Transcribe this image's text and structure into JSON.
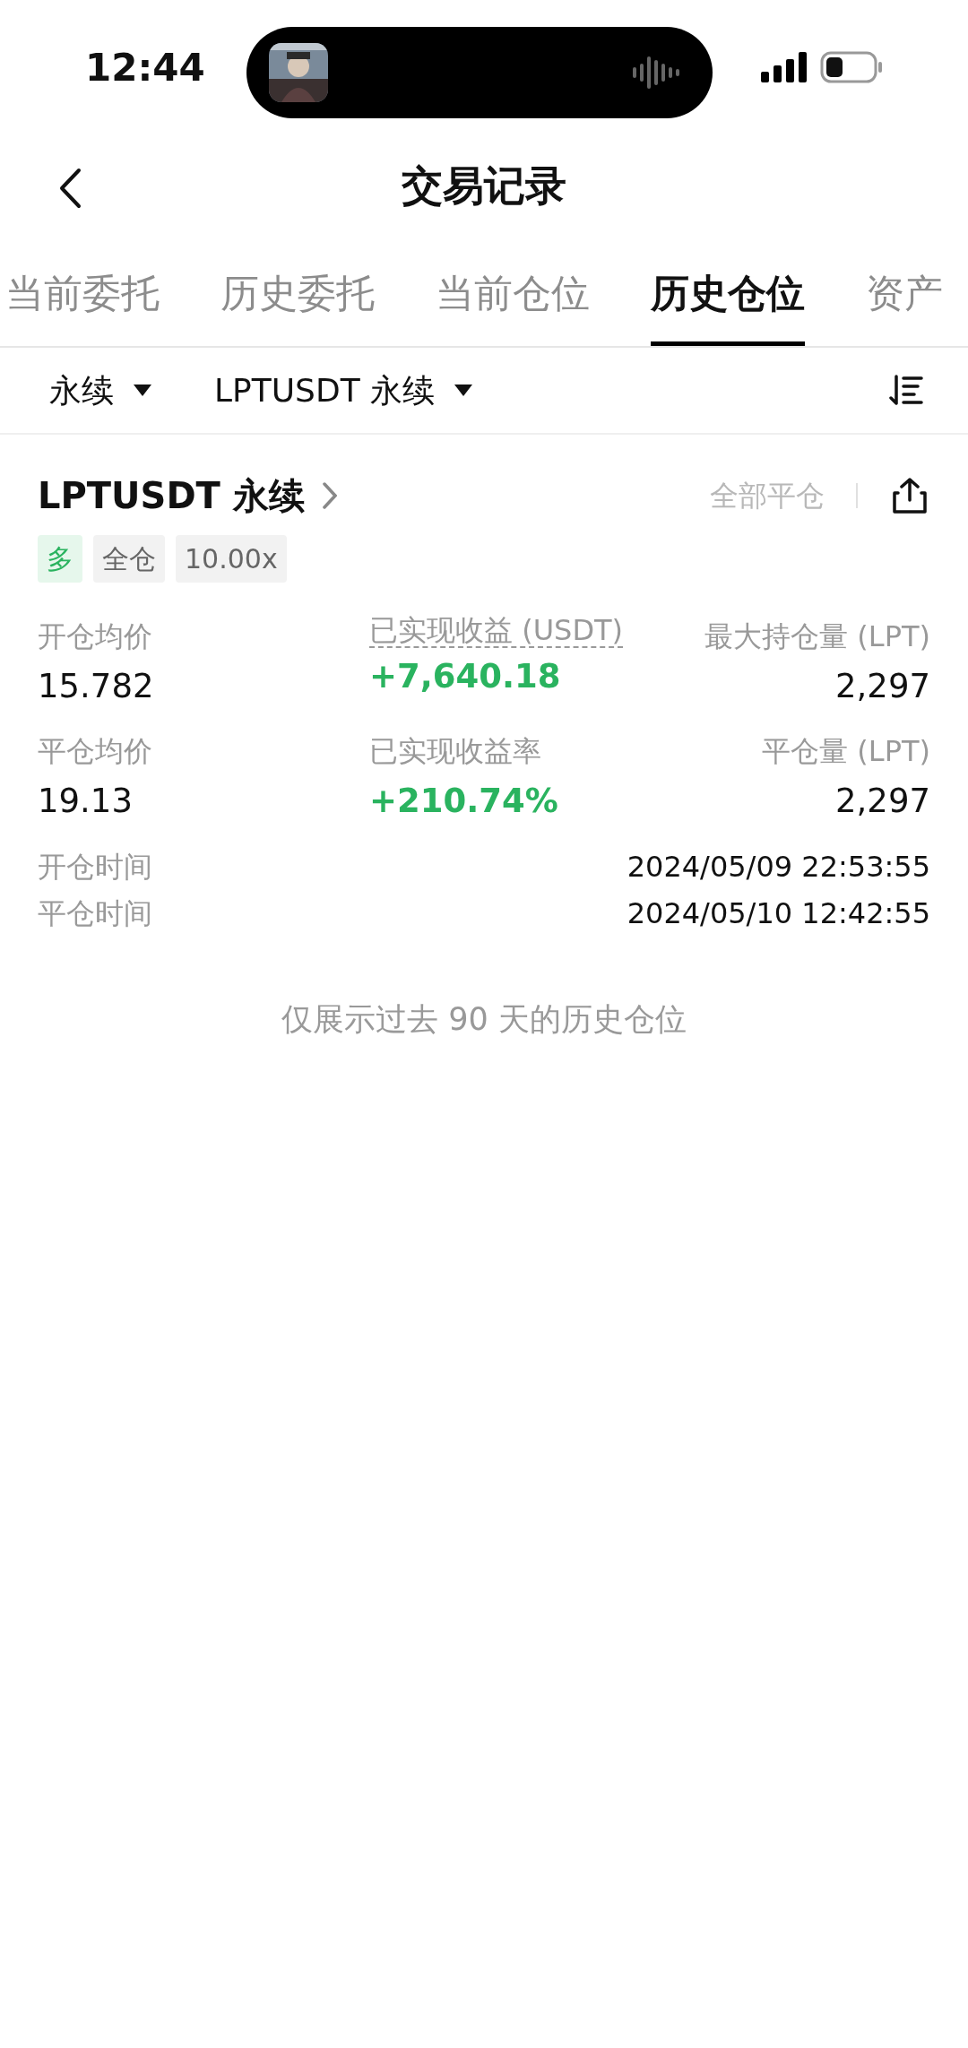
{
  "status_bar": {
    "time": "12:44"
  },
  "header": {
    "title": "交易记录"
  },
  "tabs": [
    {
      "label": "当前委托",
      "selected": false
    },
    {
      "label": "历史委托",
      "selected": false
    },
    {
      "label": "当前仓位",
      "selected": false
    },
    {
      "label": "历史仓位",
      "selected": true
    },
    {
      "label": "资产",
      "selected": false
    }
  ],
  "filters": [
    {
      "label": "永续"
    },
    {
      "label": "LPTUSDT 永续"
    }
  ],
  "position": {
    "symbol": "LPTUSDT 永续",
    "close_all": "全部平仓",
    "tags": [
      {
        "label": "多",
        "kind": "side"
      },
      {
        "label": "全仓",
        "kind": "plain"
      },
      {
        "label": "10.00x",
        "kind": "plain"
      }
    ],
    "stats": [
      {
        "label": "开仓均价",
        "value": "15.782",
        "kind": "plain"
      },
      {
        "label": "已实现收益 (USDT)",
        "value": "+7,640.18",
        "kind": "profit",
        "dashed": true
      },
      {
        "label": "最大持仓量 (LPT)",
        "value": "2,297",
        "kind": "plain"
      },
      {
        "label": "平仓均价",
        "value": "19.13",
        "kind": "plain"
      },
      {
        "label": "已实现收益率",
        "value": "+210.74%",
        "kind": "profit",
        "dashed": false
      },
      {
        "label": "平仓量 (LPT)",
        "value": "2,297",
        "kind": "plain"
      }
    ],
    "times": [
      {
        "label": "开仓时间",
        "value": "2024/05/09 22:53:55"
      },
      {
        "label": "平仓时间",
        "value": "2024/05/10 12:42:55"
      }
    ]
  },
  "footer_note": "仅展示过去 90 天的历史仓位"
}
